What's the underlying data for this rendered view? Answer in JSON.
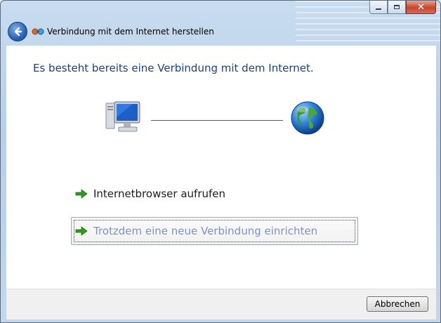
{
  "window": {
    "title": "Verbindung mit dem Internet herstellen",
    "caption_buttons": [
      "minimize-icon",
      "maximize-icon",
      "close-icon"
    ],
    "close_glyph": "✕"
  },
  "content": {
    "heading": "Es besteht bereits eine Verbindung mit dem Internet.",
    "icons": [
      "computer-icon",
      "globe-icon"
    ],
    "options": [
      {
        "icon": "green-arrow-icon",
        "label": "Internetbrowser aufrufen"
      },
      {
        "icon": "green-arrow-icon",
        "label": "Trotzdem eine neue Verbindung einrichten"
      }
    ]
  },
  "footer": {
    "cancel_label": "Abbrechen"
  },
  "colors": {
    "heading": "#1f3f7a",
    "link_disabled_blue": "#7d93c6",
    "arrow_green": "#2f9a1f"
  }
}
